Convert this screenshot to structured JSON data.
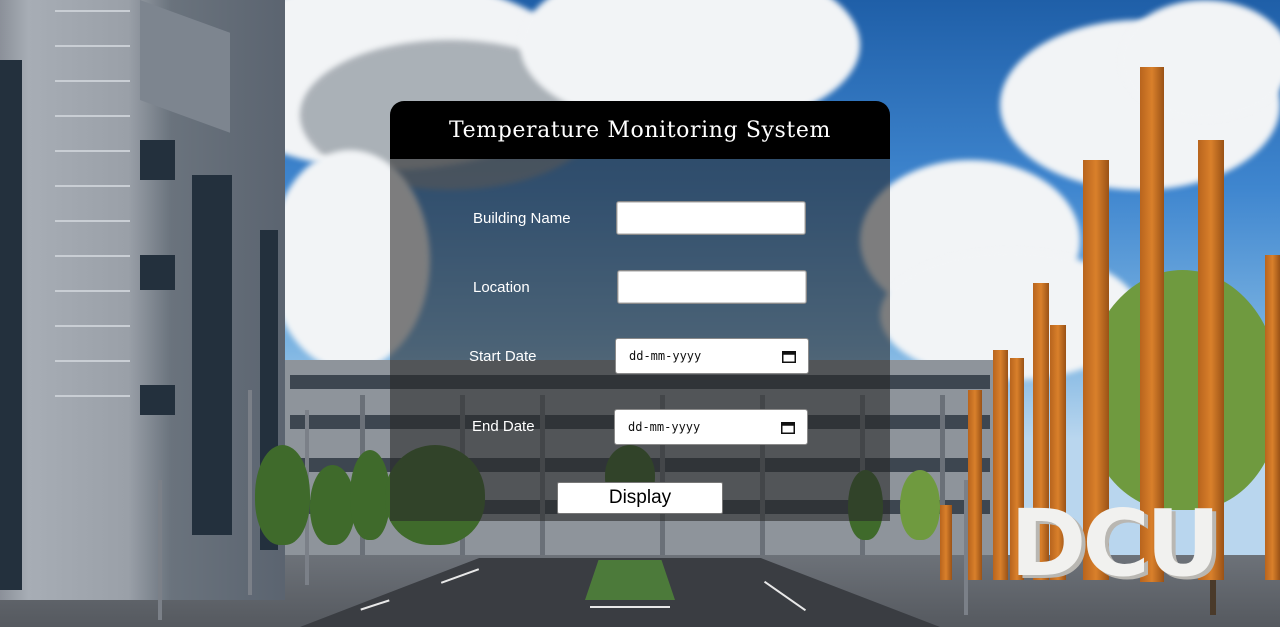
{
  "header": {
    "title": "Temperature Monitoring System"
  },
  "form": {
    "building_name": {
      "label": "Building Name",
      "value": "",
      "placeholder": ""
    },
    "location": {
      "label": "Location",
      "value": "",
      "placeholder": ""
    },
    "start_date": {
      "label": "Start Date",
      "value": "dd-mm-yyyy"
    },
    "end_date": {
      "label": "End Date",
      "value": "dd-mm-yyyy"
    },
    "submit_label": "Display"
  },
  "background": {
    "sign_text": "DCU"
  },
  "colors": {
    "header_bg": "#000000",
    "panel_bg": "rgba(40,40,40,0.58)",
    "text": "#ffffff"
  }
}
